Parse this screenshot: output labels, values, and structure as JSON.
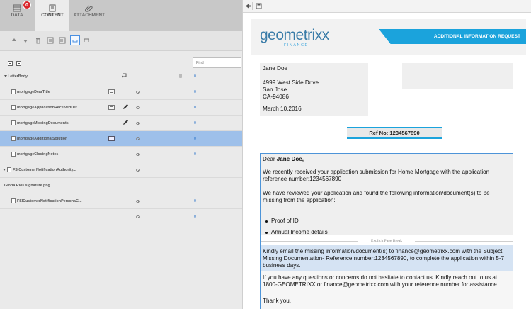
{
  "left_panel": {
    "tabs": [
      {
        "label": "DATA",
        "badge": "0",
        "icon": "data-icon"
      },
      {
        "label": "CONTENT",
        "icon": "content-icon"
      },
      {
        "label": "ATTACHMENT",
        "icon": "attachment-icon"
      }
    ],
    "find_placeholder": "Find",
    "tree": [
      {
        "label": "LetterBody",
        "count": "0"
      },
      {
        "label": "mortgageDearTitle",
        "count": "0"
      },
      {
        "label": "mortgageApplicationReceivedDet...",
        "count": "0"
      },
      {
        "label": "mortgageMissingDocuments",
        "count": "0"
      },
      {
        "label": "mortgageAdditionalSolution",
        "count": "0"
      },
      {
        "label": "mortgageClosingNotes",
        "count": "0"
      },
      {
        "label": "FSICustomerNotificationAuthority...",
        "count": ""
      },
      {
        "label": "Gloria Rios signature.png",
        "count": ""
      },
      {
        "label": "FSICustomerNotificationPersonaG...",
        "count": "0"
      },
      {
        "label": "",
        "count": "0"
      }
    ]
  },
  "document": {
    "logo_text": "geometrixx",
    "logo_sub": "FINANCE",
    "header_title": "ADDITIONAL INFORMATION REQUEST",
    "address": {
      "name": "Jane Doe",
      "line1": "4999 West Side Drive",
      "line2": "San Jose",
      "line3": "CA-94086",
      "date": "March 10,2016"
    },
    "ref": "Ref No: 1234567890",
    "dear": "Dear",
    "recipient": "Jane Doe,",
    "para1": "We recently received your application submission for Home Mortgage with the application reference number:1234567890",
    "para2": "We have reviewed your application and found the following information/document(s) to be missing from the application:",
    "items": [
      "Proof of ID",
      "Annual Income details"
    ],
    "page_break": "Explicit Page Break",
    "para3": "Kindly email the missing information/document(s) to finance@geometrixx.com with the Subject: Missing Documentation- Reference number:1234567890, to complete the application within 5-7 business days.",
    "para4": "If you have any questions or concerns do not hesitate to contact us. Kindly reach out to us at 1800-GEOMETRIXX or finance@geometrixx.com with your reference number for assistance.",
    "closing": "Thank you,"
  }
}
